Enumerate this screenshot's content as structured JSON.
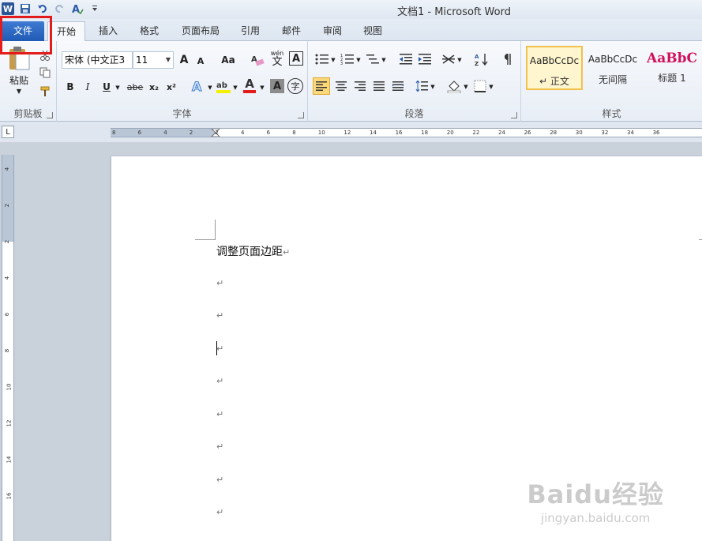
{
  "window": {
    "title": "文档1 - Microsoft Word"
  },
  "quick_access": {
    "icons": [
      "word-logo",
      "save-icon",
      "undo-icon",
      "redo-icon",
      "spelling-icon",
      "customize-icon"
    ],
    "word_logo": "W"
  },
  "tabs": {
    "file": "文件",
    "items": [
      "开始",
      "插入",
      "格式",
      "页面布局",
      "引用",
      "邮件",
      "审阅",
      "视图"
    ]
  },
  "ribbon": {
    "clipboard": {
      "label": "剪贴板",
      "paste": "粘贴"
    },
    "font": {
      "label": "字体",
      "font_name": "宋体 (中文正3",
      "font_size": "11",
      "grow": "A",
      "shrink": "A",
      "change_case": "Aa",
      "bold": "B",
      "italic": "I",
      "underline": "U",
      "strike": "abe",
      "subscript": "x₂",
      "superscript": "x²",
      "font_color_letter": "A",
      "char_shading": "A",
      "enclose": "字",
      "clear_format_glyph": "A",
      "phonetic": "wén",
      "phonetic_char": "文",
      "border_char": "A"
    },
    "paragraph": {
      "label": "段落"
    },
    "styles": {
      "label": "样式",
      "items": [
        {
          "sample": "AaBbCcDc",
          "name": "正文"
        },
        {
          "sample": "AaBbCcDc",
          "name": "无间隔"
        },
        {
          "sample": "AaBbC",
          "name": "标题 1"
        }
      ]
    }
  },
  "ruler": {
    "h_labels": [
      "8",
      "6",
      "4",
      "2",
      "2",
      "4",
      "6",
      "8",
      "10",
      "12",
      "14",
      "16",
      "18",
      "20",
      "22",
      "24",
      "26",
      "28",
      "30",
      "32",
      "34",
      "36"
    ],
    "v_labels": [
      "4",
      "2",
      "2",
      "4",
      "6",
      "8",
      "10",
      "12",
      "14",
      "16"
    ]
  },
  "document": {
    "paragraphs": [
      "调整页面边距",
      "",
      "",
      "",
      "",
      "",
      "",
      "",
      ""
    ],
    "para_mark": "↵"
  },
  "watermark": {
    "main": "Baidu经验",
    "sub": "jingyan.baidu.com"
  },
  "colors": {
    "file_tab": "#1f5bb5",
    "highlight_box": "#e31b1b",
    "title_style": "#d0105c"
  }
}
